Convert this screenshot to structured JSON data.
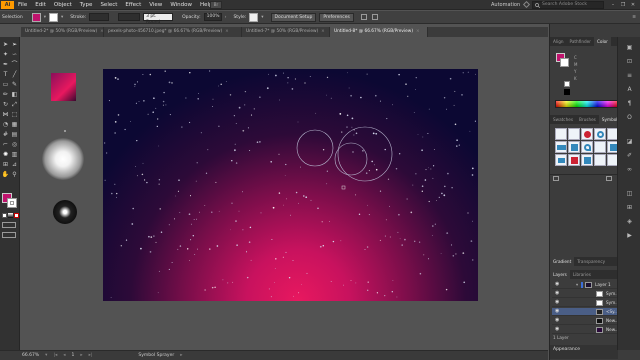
{
  "menubar": {
    "logo": "Ai",
    "items": [
      "File",
      "Edit",
      "Object",
      "Type",
      "Select",
      "Effect",
      "View",
      "Window",
      "Help"
    ],
    "bridge_label": "Br",
    "workspace": "Automation",
    "search_placeholder": "Search Adobe Stock",
    "window_controls": [
      "–",
      "❐",
      "✕"
    ]
  },
  "controlbar": {
    "selection_label": "Selection",
    "stroke_label": "Stroke:",
    "stroke_profile": "3 pt. Round",
    "opacity_label": "Opacity:",
    "opacity_value": "100%",
    "style_label": "Style:",
    "document_setup": "Document Setup",
    "preferences": "Preferences"
  },
  "tabs": [
    {
      "label": "Untitled-2* @ 50% (RGB/Preview)",
      "active": false
    },
    {
      "label": "pexels-photo-456710.jpeg* @ 66.67% (RGB/Preview)",
      "active": false
    },
    {
      "label": "Untitled-7* @ 50% (RGB/Preview)",
      "active": false
    },
    {
      "label": "Untitled-8* @ 66.67% (RGB/Preview)",
      "active": true
    }
  ],
  "statusbar": {
    "zoom": "66.67%",
    "page": "1",
    "tool_status": "Symbol Sprayer"
  },
  "panels": {
    "color_tabs": [
      "Align",
      "Pathfinder",
      "Color"
    ],
    "color_fields": [
      "C",
      "M",
      "Y",
      "K"
    ],
    "symbols_tabs": [
      "Swatches",
      "Brushes",
      "Symbols"
    ],
    "gradient_tabs": [
      "Gradient",
      "Transparency"
    ],
    "layers_tabs": [
      "Layers",
      "Libraries"
    ],
    "layers": [
      {
        "name": "Layer 1",
        "selected": false
      },
      {
        "name": "Sym...",
        "selected": false
      },
      {
        "name": "Sym...",
        "selected": false
      },
      {
        "name": "<Sy...",
        "selected": true
      },
      {
        "name": "New...",
        "selected": false
      },
      {
        "name": "New...",
        "selected": false
      }
    ],
    "layers_count": "1 Layer",
    "appearance_title": "Appearance"
  },
  "colors": {
    "accent_fill": "#c0136d",
    "artboard_edge": "#0c0833",
    "artboard_glow": "#e8185f"
  }
}
